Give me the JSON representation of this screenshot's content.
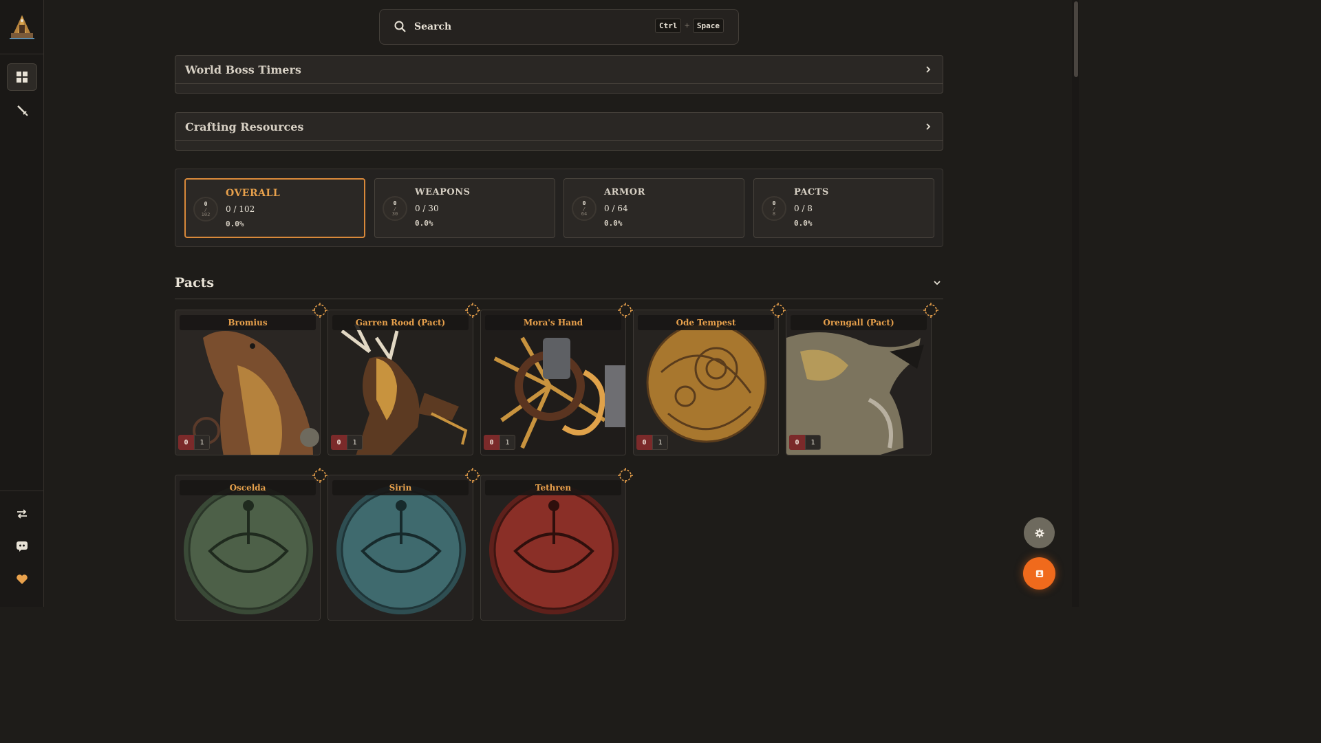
{
  "sidebar": {
    "logo_icon": "tower-logo-icon",
    "items": [
      {
        "name": "dashboard",
        "icon": "grid-icon",
        "active": true
      },
      {
        "name": "weapons",
        "icon": "sword-icon",
        "active": false
      }
    ],
    "bottom_items": [
      {
        "name": "swap",
        "icon": "swap-icon"
      },
      {
        "name": "discord",
        "icon": "discord-icon"
      },
      {
        "name": "support",
        "icon": "heart-icon"
      }
    ]
  },
  "search": {
    "label": "Search",
    "shortcut_key1": "Ctrl",
    "shortcut_plus": "+",
    "shortcut_key2": "Space"
  },
  "panels": {
    "boss_timers": "World Boss Timers",
    "crafting": "Crafting Resources"
  },
  "stats": [
    {
      "label": "OVERALL",
      "owned": "0",
      "total": "102",
      "count": "0 / 102",
      "percent": "0.0%",
      "active": true
    },
    {
      "label": "WEAPONS",
      "owned": "0",
      "total": "30",
      "count": "0 / 30",
      "percent": "0.0%",
      "active": false
    },
    {
      "label": "ARMOR",
      "owned": "0",
      "total": "64",
      "count": "0 / 64",
      "percent": "0.0%",
      "active": false
    },
    {
      "label": "PACTS",
      "owned": "0",
      "total": "8",
      "count": "0 / 8",
      "percent": "0.0%",
      "active": false
    }
  ],
  "section": {
    "title": "Pacts"
  },
  "pacts": [
    {
      "name": "Bromius",
      "owned": "0",
      "total": "1"
    },
    {
      "name": "Garren Rood (Pact)",
      "owned": "0",
      "total": "1"
    },
    {
      "name": "Mora's Hand",
      "owned": "0",
      "total": "1"
    },
    {
      "name": "Ode Tempest",
      "owned": "0",
      "total": "1"
    },
    {
      "name": "Orengall (Pact)",
      "owned": "0",
      "total": "1"
    },
    {
      "name": "Oscelda",
      "owned": "0",
      "total": "1"
    },
    {
      "name": "Sirin",
      "owned": "0",
      "total": "1"
    },
    {
      "name": "Tethren",
      "owned": "0",
      "total": "1"
    }
  ],
  "colors": {
    "accent": "#e8a14c",
    "active_border": "#d9893a",
    "owned_badge": "#7b2a2a",
    "fab_orange": "#f06a1c",
    "oscelda_seal": "#4d6048",
    "sirin_seal": "#3f6a6e",
    "tethren_seal": "#8a2f27"
  }
}
